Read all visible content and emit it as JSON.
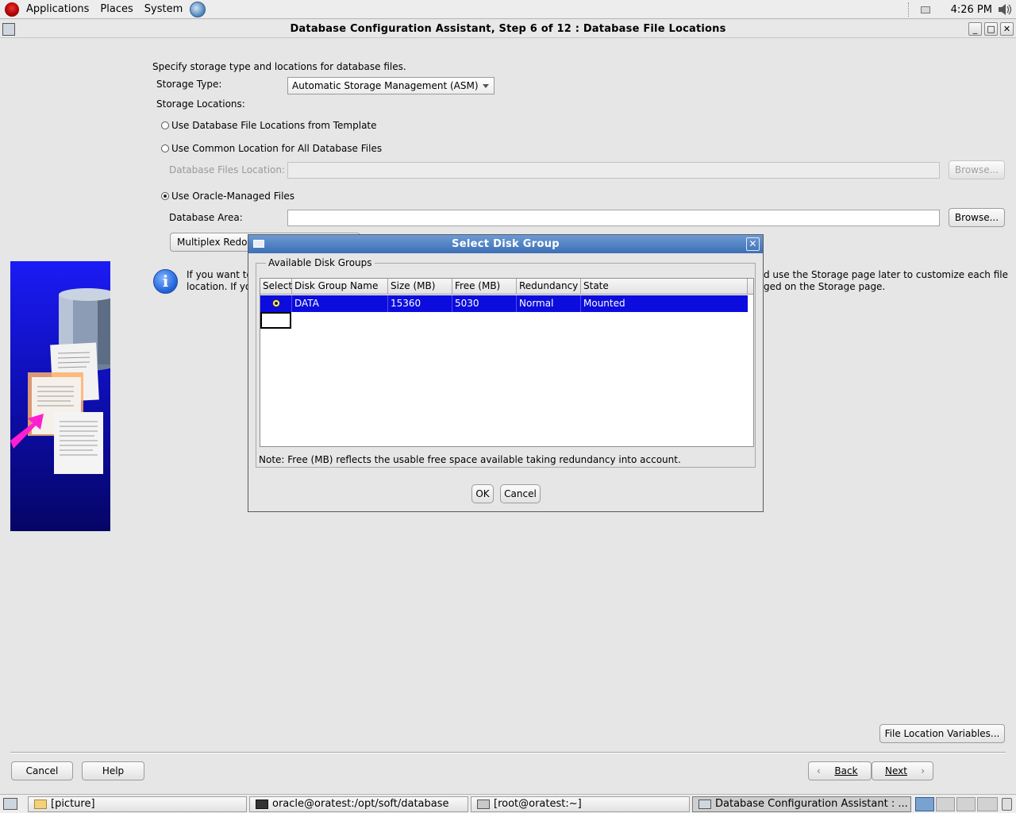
{
  "top_panel": {
    "menus": [
      "Applications",
      "Places",
      "System"
    ],
    "clock": "4:26 PM"
  },
  "window": {
    "title": "Database Configuration Assistant, Step 6 of 12 : Database File Locations",
    "minimize": "_",
    "maximize": "□",
    "close": "✕"
  },
  "main": {
    "intro": "Specify storage type and locations for database files.",
    "storage_type_label": "Storage Type:",
    "storage_type_value": "Automatic Storage Management (ASM)",
    "storage_locations_label": "Storage Locations:",
    "option_template": "Use Database File Locations from Template",
    "option_common": "Use Common Location for All Database Files",
    "db_files_location_label": "Database Files Location:",
    "browse_label": "Browse...",
    "option_omf": "Use Oracle-Managed Files",
    "db_area_label": "Database Area:",
    "multiplex_label": "Multiplex Redo",
    "info_left_1": "If you want to",
    "info_left_2": "location. If yo",
    "info_right_1": "d use the Storage page later to customize each file",
    "info_right_2": "ged on the Storage page.",
    "file_location_variables": "File Location Variables..."
  },
  "footer": {
    "cancel": "Cancel",
    "help": "Help",
    "back": "Back",
    "next": "Next"
  },
  "dialog": {
    "title": "Select Disk Group",
    "close": "✕",
    "group_label": "Available Disk Groups",
    "columns": [
      "Select",
      "Disk Group Name",
      "Size (MB)",
      "Free (MB)",
      "Redundancy",
      "State"
    ],
    "rows": [
      {
        "name": "DATA",
        "size": "15360",
        "free": "5030",
        "redundancy": "Normal",
        "state": "Mounted",
        "selected": true
      }
    ],
    "note": "Note:  Free (MB) reflects the usable free space available taking redundancy into account.",
    "ok": "OK",
    "cancel": "Cancel"
  },
  "taskbar": {
    "tasks": [
      "[picture]",
      "oracle@oratest:/opt/soft/database",
      "[root@oratest:~]",
      "Database Configuration Assistant : ..."
    ]
  },
  "colors": {
    "selection": "#0c0cde",
    "dialog_title": "#3d6fb6",
    "side_image": "#1b1bf5"
  }
}
